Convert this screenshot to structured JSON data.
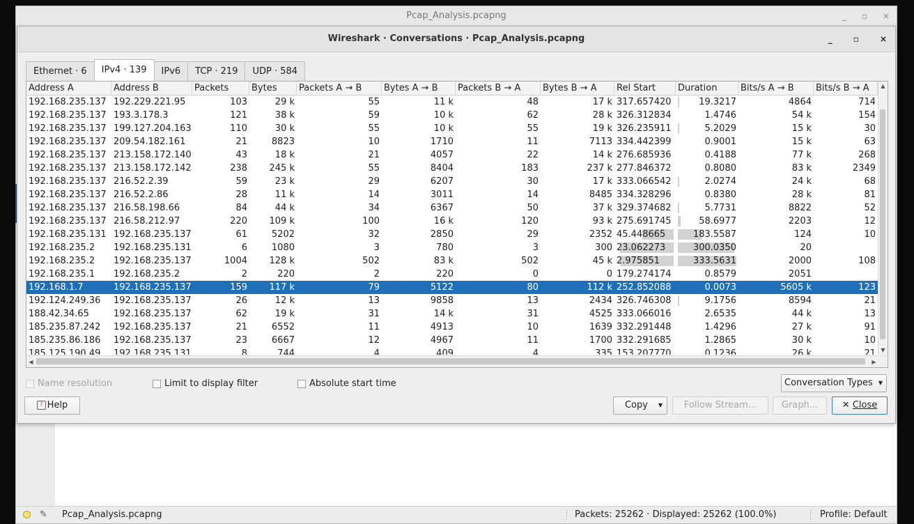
{
  "main_window": {
    "title": "Pcap_Analysis.pcapng",
    "controls": {
      "minimize": "_",
      "maximize": "▫",
      "close": "×"
    }
  },
  "dialog": {
    "title": "Wireshark · Conversations · Pcap_Analysis.pcapng",
    "controls": {
      "minimize": "_",
      "maximize": "▫",
      "close": "×"
    }
  },
  "tabs": [
    {
      "label": "Ethernet · 6",
      "active": false
    },
    {
      "label": "IPv4 · 139",
      "active": true
    },
    {
      "label": "IPv6",
      "active": false
    },
    {
      "label": "TCP · 219",
      "active": false
    },
    {
      "label": "UDP · 584",
      "active": false
    }
  ],
  "table": {
    "columns": [
      "Address A",
      "Address B",
      "Packets",
      "Bytes",
      "Packets A → B",
      "Bytes A → B",
      "Packets B → A",
      "Bytes B → A",
      "Rel Start",
      "Duration",
      "Bits/s A → B",
      "Bits/s B → A"
    ],
    "sort_indicator": "▲",
    "rows": [
      {
        "cells": [
          "192.168.235.137",
          "192.229.221.95",
          "103",
          "29 k",
          "55",
          "11 k",
          "48",
          "17 k",
          "317.657420",
          "19.3217",
          "4864",
          "714"
        ],
        "rel_start_bar": 0,
        "duration_bar": 0.006
      },
      {
        "cells": [
          "192.168.235.137",
          "193.3.178.3",
          "121",
          "38 k",
          "59",
          "10 k",
          "62",
          "28 k",
          "326.312834",
          "1.4746",
          "54 k",
          "154"
        ],
        "rel_start_bar": 0,
        "duration_bar": 0
      },
      {
        "cells": [
          "192.168.235.137",
          "199.127.204.163",
          "110",
          "30 k",
          "55",
          "10 k",
          "55",
          "19 k",
          "326.235911",
          "5.2029",
          "15 k",
          "30"
        ],
        "rel_start_bar": 0,
        "duration_bar": 0.002
      },
      {
        "cells": [
          "192.168.235.137",
          "209.54.182.161",
          "21",
          "8823",
          "10",
          "1710",
          "11",
          "7113",
          "334.442399",
          "0.9001",
          "15 k",
          "63"
        ],
        "rel_start_bar": 0,
        "duration_bar": 0
      },
      {
        "cells": [
          "192.168.235.137",
          "213.158.172.140",
          "43",
          "18 k",
          "21",
          "4057",
          "22",
          "14 k",
          "276.685936",
          "0.4188",
          "77 k",
          "268"
        ],
        "rel_start_bar": 0,
        "duration_bar": 0
      },
      {
        "cells": [
          "192.168.235.137",
          "213.158.172.142",
          "238",
          "245 k",
          "55",
          "8404",
          "183",
          "237 k",
          "277.846372",
          "0.8080",
          "83 k",
          "2349"
        ],
        "rel_start_bar": 0,
        "duration_bar": 0
      },
      {
        "cells": [
          "192.168.235.137",
          "216.52.2.39",
          "59",
          "23 k",
          "29",
          "6207",
          "30",
          "17 k",
          "333.066542",
          "2.0274",
          "24 k",
          "68"
        ],
        "rel_start_bar": 0,
        "duration_bar": 0.002
      },
      {
        "cells": [
          "192.168.235.137",
          "216.52.2.86",
          "28",
          "11 k",
          "14",
          "3011",
          "14",
          "8485",
          "334.328296",
          "0.8380",
          "28 k",
          "81"
        ],
        "rel_start_bar": 0,
        "duration_bar": 0
      },
      {
        "cells": [
          "192.168.235.137",
          "216.58.198.66",
          "84",
          "44 k",
          "34",
          "6367",
          "50",
          "37 k",
          "329.374682",
          "5.7731",
          "8822",
          "52"
        ],
        "rel_start_bar": 0,
        "duration_bar": 0.002
      },
      {
        "cells": [
          "192.168.235.137",
          "216.58.212.97",
          "220",
          "109 k",
          "100",
          "16 k",
          "120",
          "93 k",
          "275.691745",
          "58.6977",
          "2203",
          "12"
        ],
        "rel_start_bar": 0,
        "duration_bar": 0.05
      },
      {
        "cells": [
          "192.168.235.131",
          "192.168.235.137",
          "61",
          "5202",
          "32",
          "2850",
          "29",
          "2352",
          "45.448665",
          "183.5587",
          "124",
          "10"
        ],
        "rel_start_bar": 0.55,
        "duration_bar": 0.4
      },
      {
        "cells": [
          "192.168.235.2",
          "192.168.235.131",
          "6",
          "1080",
          "3",
          "780",
          "3",
          "300",
          "23.062273",
          "300.0350",
          "20",
          ""
        ],
        "rel_start_bar": 0.94,
        "duration_bar": 0.96
      },
      {
        "cells": [
          "192.168.235.2",
          "192.168.235.137",
          "1004",
          "128 k",
          "502",
          "83 k",
          "502",
          "45 k",
          "2.975851",
          "333.5631",
          "2000",
          "108"
        ],
        "rel_start_bar": 0.94,
        "duration_bar": 1.0
      },
      {
        "cells": [
          "192.168.235.1",
          "192.168.235.2",
          "2",
          "220",
          "2",
          "220",
          "0",
          "0",
          "179.274174",
          "0.8579",
          "2051",
          ""
        ],
        "rel_start_bar": 0,
        "duration_bar": 0
      },
      {
        "cells": [
          "192.168.1.7",
          "192.168.235.137",
          "159",
          "117 k",
          "79",
          "5122",
          "80",
          "112 k",
          "252.852088",
          "0.0073",
          "5605 k",
          "123"
        ],
        "rel_start_bar": 0,
        "duration_bar": 0,
        "selected": true
      },
      {
        "cells": [
          "192.124.249.36",
          "192.168.235.137",
          "26",
          "12 k",
          "13",
          "9858",
          "13",
          "2434",
          "326.746308",
          "9.1756",
          "8594",
          "21"
        ],
        "rel_start_bar": 0,
        "duration_bar": 0.003
      },
      {
        "cells": [
          "188.42.34.65",
          "192.168.235.137",
          "62",
          "19 k",
          "31",
          "14 k",
          "31",
          "4525",
          "333.066016",
          "2.6535",
          "44 k",
          "13"
        ],
        "rel_start_bar": 0,
        "duration_bar": 0
      },
      {
        "cells": [
          "185.235.87.242",
          "192.168.235.137",
          "21",
          "6552",
          "11",
          "4913",
          "10",
          "1639",
          "332.291448",
          "1.4296",
          "27 k",
          "91"
        ],
        "rel_start_bar": 0,
        "duration_bar": 0
      },
      {
        "cells": [
          "185.235.86.186",
          "192.168.235.137",
          "23",
          "6667",
          "12",
          "4967",
          "11",
          "1700",
          "332.291685",
          "1.2865",
          "30 k",
          "10"
        ],
        "rel_start_bar": 0,
        "duration_bar": 0
      },
      {
        "cells": [
          "185.125.190.49",
          "192.168.235.131",
          "8",
          "744",
          "4",
          "409",
          "4",
          "335",
          "153.207770",
          "0.1236",
          "26 k",
          "21"
        ],
        "rel_start_bar": 0,
        "duration_bar": 0
      }
    ]
  },
  "options": {
    "name_resolution": "Name resolution",
    "limit_display_filter": "Limit to display filter",
    "absolute_start_time": "Absolute start time",
    "conversation_types": "Conversation Types"
  },
  "buttons": {
    "help": "Help",
    "copy": "Copy",
    "follow_stream": "Follow Stream...",
    "graph": "Graph...",
    "close": "Close",
    "close_icon": "✕"
  },
  "statusbar": {
    "file": "Pcap_Analysis.pcapng",
    "packets": "Packets: 25262 · Displayed: 25262 (100.0%)",
    "profile": "Profile: Default"
  },
  "colors": {
    "selection": "#1d6fb8",
    "bar": "#d2d2d2"
  }
}
